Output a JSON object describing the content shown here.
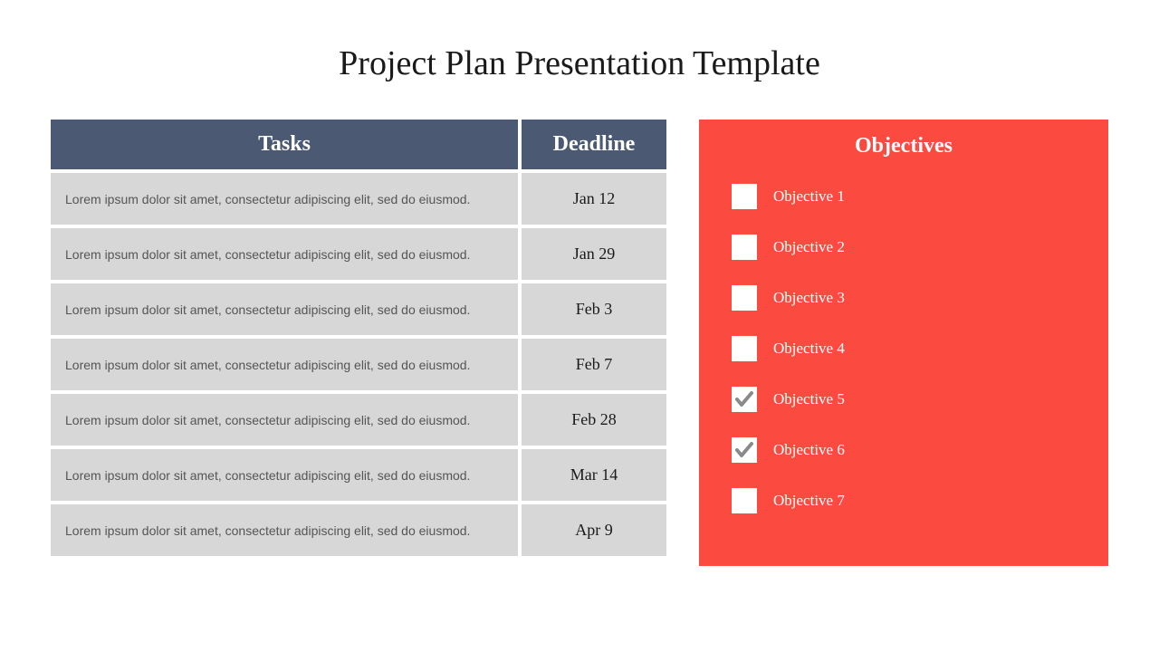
{
  "title": "Project Plan Presentation Template",
  "table": {
    "header": {
      "tasks": "Tasks",
      "deadline": "Deadline"
    },
    "rows": [
      {
        "task": "Lorem ipsum dolor sit amet, consectetur adipiscing elit, sed do eiusmod.",
        "deadline": "Jan 12"
      },
      {
        "task": "Lorem ipsum dolor sit amet, consectetur adipiscing elit, sed do eiusmod.",
        "deadline": "Jan 29"
      },
      {
        "task": "Lorem ipsum dolor sit amet, consectetur adipiscing elit, sed do eiusmod.",
        "deadline": "Feb 3"
      },
      {
        "task": "Lorem ipsum dolor sit amet, consectetur adipiscing elit, sed do eiusmod.",
        "deadline": "Feb 7"
      },
      {
        "task": "Lorem ipsum dolor sit amet, consectetur adipiscing elit, sed do eiusmod.",
        "deadline": "Feb 28"
      },
      {
        "task": "Lorem ipsum dolor sit amet, consectetur adipiscing elit, sed do eiusmod.",
        "deadline": "Mar 14"
      },
      {
        "task": "Lorem ipsum dolor sit amet, consectetur adipiscing elit, sed do eiusmod.",
        "deadline": "Apr 9"
      }
    ]
  },
  "objectives": {
    "title": "Objectives",
    "items": [
      {
        "label": "Objective 1",
        "checked": false
      },
      {
        "label": " Objective 2",
        "checked": false
      },
      {
        "label": "Objective 3",
        "checked": false
      },
      {
        "label": "Objective 4",
        "checked": false
      },
      {
        "label": "Objective 5",
        "checked": true
      },
      {
        "label": "Objective 6",
        "checked": true
      },
      {
        "label": "Objective 7",
        "checked": false
      }
    ]
  },
  "colors": {
    "header_bg": "#4b5a72",
    "row_bg": "#d7d7d7",
    "objectives_bg": "#fb4a3f"
  }
}
